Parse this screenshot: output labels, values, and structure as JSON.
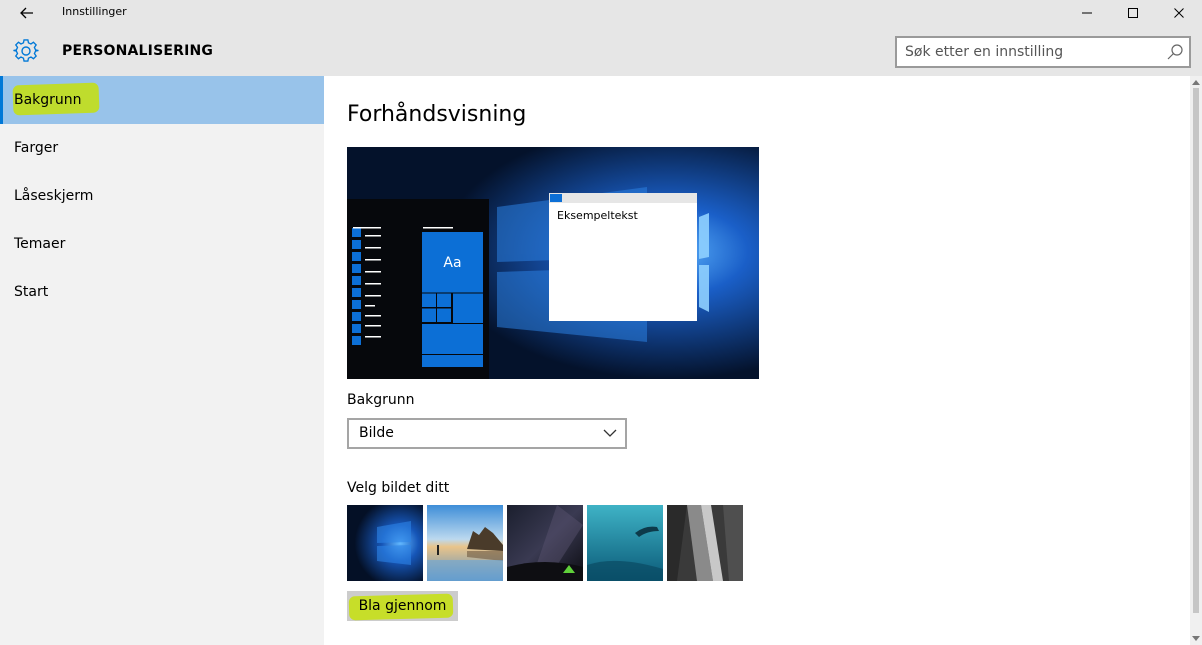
{
  "window": {
    "title": "Innstillinger"
  },
  "header": {
    "section_title": "PERSONALISERING",
    "search_placeholder": "Søk etter en innstilling"
  },
  "sidebar": {
    "items": [
      {
        "label": "Bakgrunn",
        "active": true
      },
      {
        "label": "Farger",
        "active": false
      },
      {
        "label": "Låseskjerm",
        "active": false
      },
      {
        "label": "Temaer",
        "active": false
      },
      {
        "label": "Start",
        "active": false
      }
    ]
  },
  "main": {
    "heading": "Forhåndsvisning",
    "preview": {
      "tile_label": "Aa",
      "window_text": "Eksempeltekst"
    },
    "background_label": "Bakgrunn",
    "background_value": "Bilde",
    "choose_label": "Velg bildet ditt",
    "browse_label": "Bla gjennom"
  },
  "colors": {
    "accent": "#0078d7",
    "nav_active_bg": "#98c3ea",
    "highlight": "#c5e10c",
    "chrome_bg": "#e6e6e6"
  }
}
